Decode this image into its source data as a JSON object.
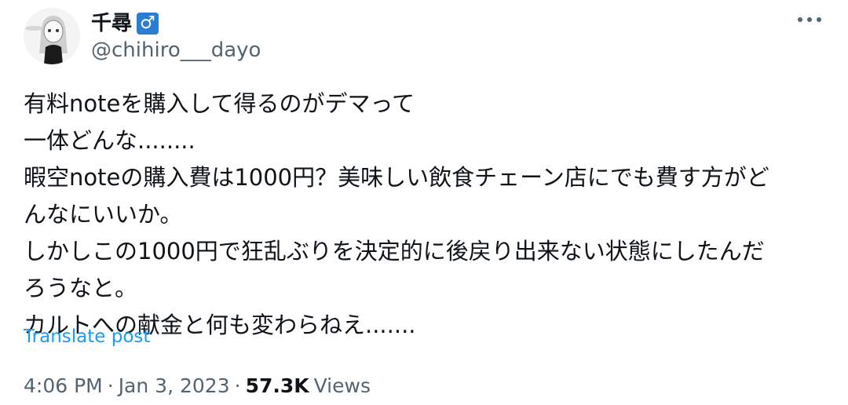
{
  "author": {
    "display_name": "千尋",
    "gender_badge": "♂",
    "handle": "@chihiro___dayo"
  },
  "post": {
    "lines": [
      "有料noteを購入して得るのがデマって",
      "一体どんな........",
      "暇空noteの購入費は1000円？美味しい飲食チェーン店にでも費す方がど",
      "んなにいいか。",
      "しかしこの1000円で狂乱ぶりを決定的に後戻り出来ない状態にしたんだ",
      "ろうなと。",
      "カルトへの献金と何も変わらねえ......."
    ],
    "translate_label": "Translate post"
  },
  "meta": {
    "time": "4:06 PM",
    "separator": "·",
    "date": "Jan 3, 2023",
    "separator2": "·",
    "views_count": "57.3K",
    "views_label": "Views"
  },
  "colors": {
    "text": "#0f1419",
    "secondary": "#536471",
    "link": "#1d9bf0",
    "badge": "#2b7cd3"
  }
}
